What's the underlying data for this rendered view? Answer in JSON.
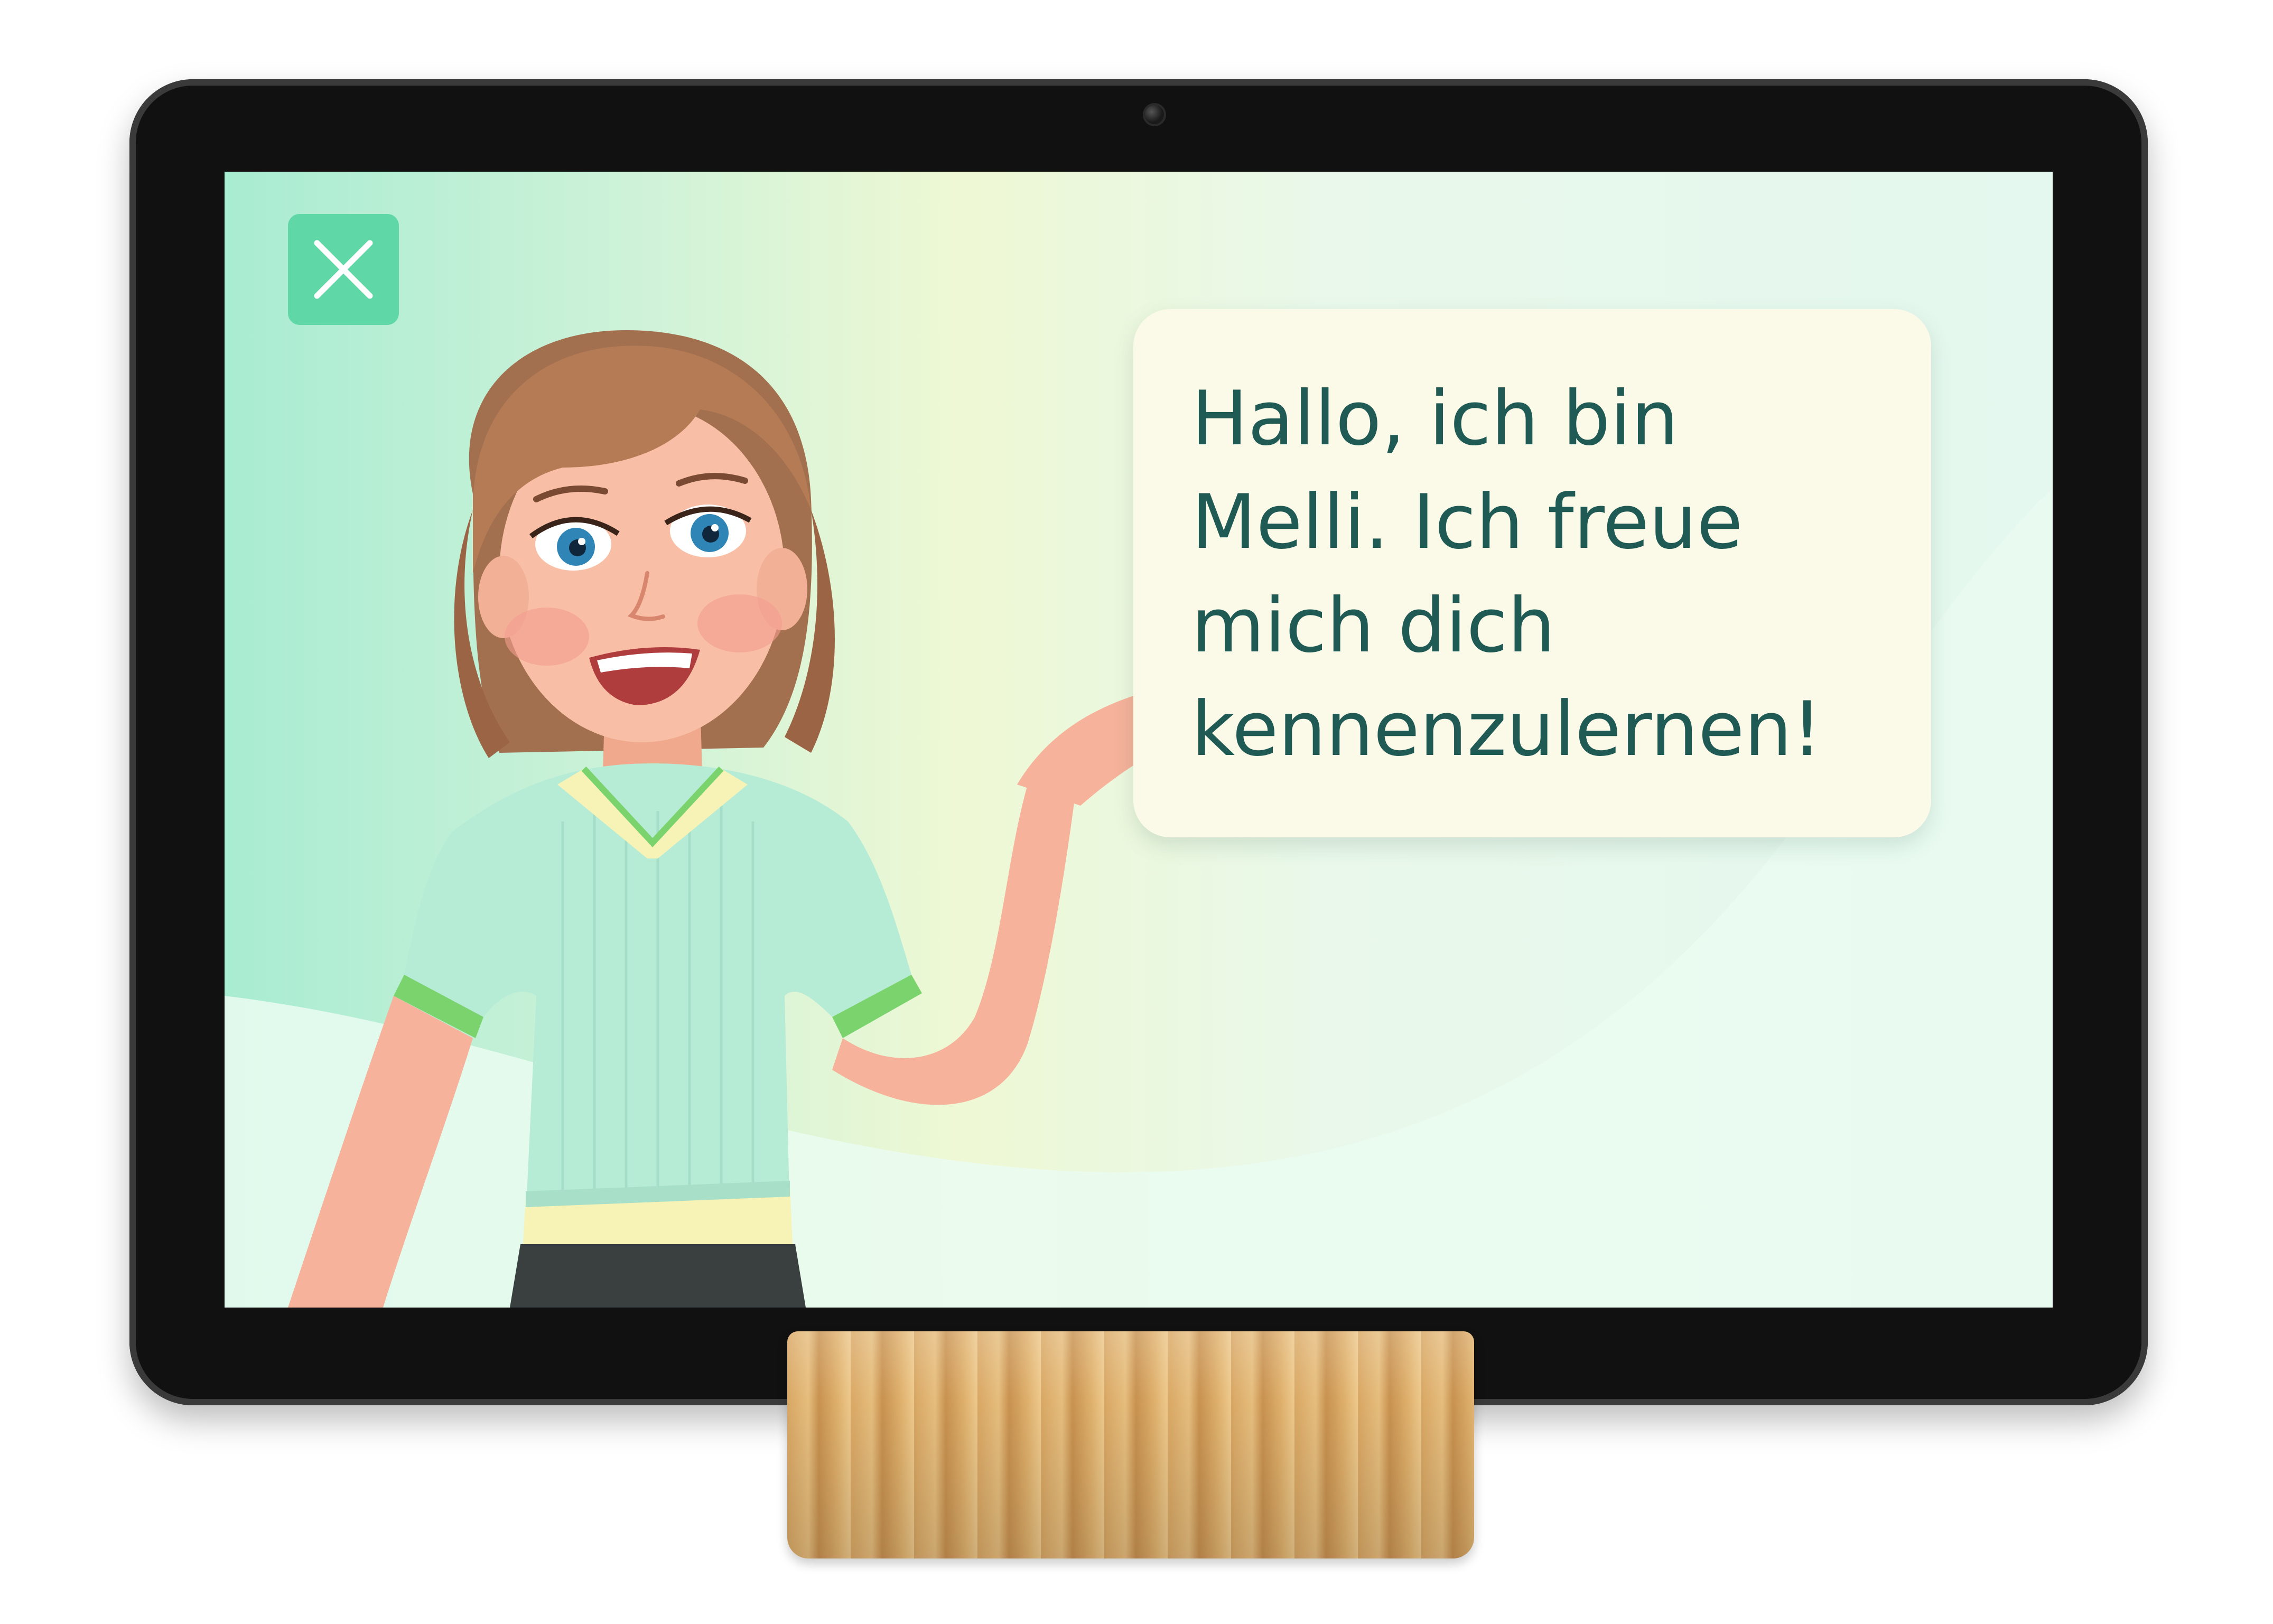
{
  "app": {
    "close_button": {
      "icon": "close-icon",
      "color": "#5fd7a6"
    },
    "speech_bubble": {
      "text": "Hallo, ich bin\nMelli. Ich freue\nmich dich\nkennenzulernen!",
      "text_color": "#1f5a54",
      "background": "#fbf9e7"
    },
    "character": {
      "icon": "teacher-character-illustration"
    },
    "device": {
      "type": "tablet",
      "stand": "bamboo-stand"
    },
    "colors": {
      "accent": "#5fd7a6",
      "screen_gradient_start": "#a8ecd2",
      "screen_gradient_end": "#e4f8ef"
    }
  }
}
